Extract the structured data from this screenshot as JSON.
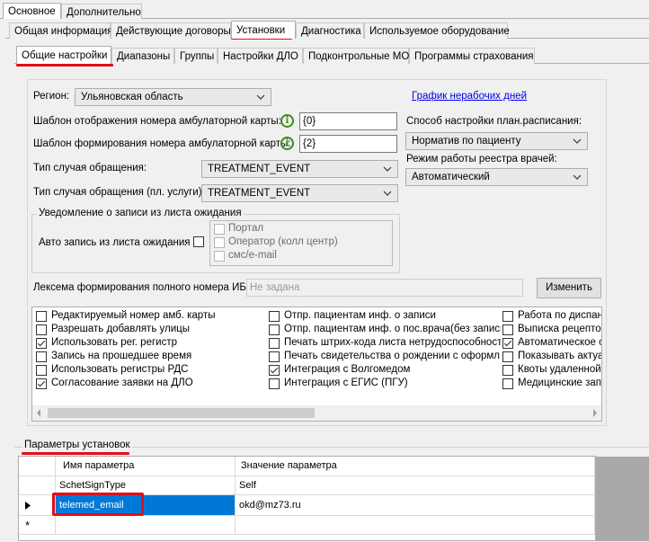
{
  "top_tabs": [
    "Основное",
    "Дополнительно"
  ],
  "second_tabs": [
    "Общая информация",
    "Действующие договоры",
    "Установки",
    "Диагностика",
    "Используемое оборудование"
  ],
  "third_tabs": [
    "Общие настройки",
    "Диапазоны",
    "Группы",
    "Настройки ДЛО",
    "Подконтрольные МО",
    "Программы страхования"
  ],
  "settings": {
    "region_label": "Регион:",
    "region_value": "Ульяновская область",
    "schedule_link": "График нерабочих дней",
    "display_template_label": "Шаблон отображения номера амбулаторной карты:",
    "display_template_value": "{0}",
    "form_template_label": "Шаблон формирования номера амбулаторной карты:",
    "form_template_value": "{2}",
    "plan_method_label": "Способ настройки план.расписания:",
    "plan_method_value": "Норматив по пациенту",
    "case_type_label": "Тип случая обращения:",
    "case_type_value": "TREATMENT_EVENT",
    "registry_mode_label": "Режим работы реестра врачей:",
    "registry_mode_value": "Автоматический",
    "case_type_paid_label": "Тип случая обращения (пл. услуги):",
    "case_type_paid_value": "TREATMENT_EVENT",
    "waitlist_group_title": "Уведомление о записи из листа ожидания",
    "auto_record_label": "Авто запись из листа ожидания",
    "notify_channels": [
      "Портал",
      "Оператор (колл центр)",
      "смс/e-mail"
    ],
    "lexeme_label": "Лексема формирования полного номера ИБ",
    "lexeme_placeholder": "Не задана",
    "change_button": "Изменить"
  },
  "checkbox_columns": [
    [
      {
        "label": "Редактируемый номер амб. карты",
        "checked": false
      },
      {
        "label": "Разрешать добавлять улицы",
        "checked": false
      },
      {
        "label": "Использовать рег. регистр",
        "checked": true
      },
      {
        "label": "Запись на прошедшее время",
        "checked": false
      },
      {
        "label": "Использовать регистры РДС",
        "checked": false
      },
      {
        "label": "Согласование заявки на ДЛО",
        "checked": true
      }
    ],
    [
      {
        "label": "Отпр. пациентам инф. о записи",
        "checked": false
      },
      {
        "label": "Отпр. пациентам инф. о пос.врача(без записи)",
        "checked": false
      },
      {
        "label": "Печать штрих-кода листа нетрудоспособности",
        "checked": false
      },
      {
        "label": "Печать свидетельства о рождении с оформл",
        "checked": false
      },
      {
        "label": "Интеграция с Волгомедом",
        "checked": true
      },
      {
        "label": "Интеграция с ЕГИС (ПГУ)",
        "checked": false
      }
    ],
    [
      {
        "label": "Работа по диспан",
        "checked": false
      },
      {
        "label": "Выписка рецептов",
        "checked": false
      },
      {
        "label": "Автоматическое с",
        "checked": true
      },
      {
        "label": "Показывать актуа",
        "checked": false
      },
      {
        "label": "Квоты удаленной",
        "checked": false
      },
      {
        "label": "Медицинские запи",
        "checked": false
      }
    ]
  ],
  "params": {
    "title": "Параметры установок",
    "col_name": "Имя параметра",
    "col_value": "Значение параметра",
    "rows": [
      {
        "name": "SchetSignType",
        "value": "Self"
      },
      {
        "name": "telemed_email",
        "value": "okd@mz73.ru"
      }
    ],
    "new_row_marker": "*"
  },
  "colors": {
    "highlight_red": "#e0101a",
    "selection_blue": "#0078d7",
    "check_green": "#3c8a1e"
  }
}
